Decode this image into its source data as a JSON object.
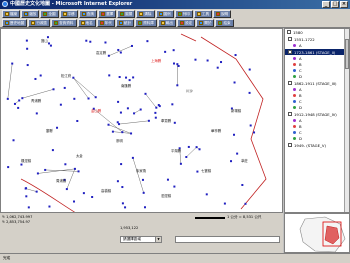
{
  "window": {
    "title": "中國歷史文化地圖 - Microsoft Internet Explorer"
  },
  "toolbar": {
    "row1": [
      {
        "label": "檔案",
        "color": "yellow"
      },
      {
        "label": "縮放",
        "color": "blue"
      },
      {
        "label": "全圖",
        "color": "green"
      },
      {
        "label": "平移",
        "color": "yellow"
      },
      {
        "label": "查詢",
        "color": "blue"
      },
      {
        "label": "選擇",
        "color": "red"
      },
      {
        "label": "圖層",
        "color": "green"
      },
      {
        "label": "清除",
        "color": "yellow"
      },
      {
        "label": "圖例",
        "color": "blue"
      },
      {
        "label": "列印",
        "color": "green"
      },
      {
        "label": "工具",
        "color": "yellow"
      },
      {
        "label": "說明",
        "color": "red"
      }
    ],
    "row2": [
      {
        "label": "歷史地圖",
        "color": "blue"
      },
      {
        "label": "行政區",
        "color": "yellow"
      },
      {
        "label": "查詢資料",
        "color": "green"
      },
      {
        "label": "地名",
        "color": "yellow"
      },
      {
        "label": "年代",
        "color": "red"
      },
      {
        "label": "統計",
        "color": "blue"
      },
      {
        "label": "資料庫",
        "color": "green"
      },
      {
        "label": "輸出",
        "color": "yellow"
      },
      {
        "label": "設定",
        "color": "red"
      },
      {
        "label": "關於",
        "color": "blue"
      },
      {
        "label": "結束",
        "color": "green"
      }
    ]
  },
  "map": {
    "places": [
      {
        "t": "寶山",
        "red": false
      },
      {
        "t": "嘉定縣",
        "red": false
      },
      {
        "t": "上海縣",
        "red": true
      },
      {
        "t": "松江府",
        "red": false
      },
      {
        "t": "南匯縣",
        "red": false
      },
      {
        "t": "川沙",
        "red": false
      },
      {
        "t": "青浦縣",
        "red": false
      },
      {
        "t": "金山縣",
        "red": true
      },
      {
        "t": "奉賢縣",
        "red": false
      },
      {
        "t": "華亭縣",
        "red": false
      },
      {
        "t": "婁縣",
        "red": false
      },
      {
        "t": "崇明",
        "red": false
      },
      {
        "t": "太倉",
        "red": false
      },
      {
        "t": "平湖縣",
        "red": false
      },
      {
        "t": "楓涇鎮",
        "red": false
      },
      {
        "t": "朱家角",
        "red": false
      },
      {
        "t": "七寶鎮",
        "red": false
      },
      {
        "t": "周浦鎮",
        "red": false
      },
      {
        "t": "高橋鎮",
        "red": false
      },
      {
        "t": "泗涇鎮",
        "red": false
      },
      {
        "t": "新場鎮",
        "red": false
      },
      {
        "t": "莘莊",
        "red": false
      }
    ]
  },
  "legend": {
    "top": "1580",
    "groups": [
      {
        "title": "1551-1722",
        "selected": false,
        "items": [
          {
            "label": "A",
            "color": "#9b30d0"
          }
        ]
      },
      {
        "title": "1723-1861 (STAGE_II)",
        "selected": true,
        "items": [
          {
            "label": "A",
            "color": "#9b30d0"
          },
          {
            "label": "B",
            "color": "#e04040"
          },
          {
            "label": "C",
            "color": "#3060d0"
          },
          {
            "label": "D",
            "color": "#30a040"
          }
        ]
      },
      {
        "title": "1862-1911 (STAGE_III)",
        "selected": false,
        "items": [
          {
            "label": "A",
            "color": "#9b30d0"
          },
          {
            "label": "B",
            "color": "#e04040"
          },
          {
            "label": "C",
            "color": "#3060d0"
          },
          {
            "label": "D",
            "color": "#30a040"
          }
        ]
      },
      {
        "title": "1912-1948 (STAGE_IV)",
        "selected": false,
        "items": [
          {
            "label": "A",
            "color": "#9b30d0"
          },
          {
            "label": "B",
            "color": "#e04040"
          },
          {
            "label": "C",
            "color": "#3060d0"
          },
          {
            "label": "D",
            "color": "#30a040"
          }
        ]
      },
      {
        "title": "1949- (STAGE_V)",
        "selected": false,
        "items": []
      }
    ]
  },
  "status": {
    "coord_y1": "Y: 1,062,743.997",
    "coord_y2": "Y: 2,853,754.97",
    "coord_x": "1,953,122",
    "scale_label": "1 公分 = 8,531 公尺",
    "select_value": "請選擇區域",
    "ie_status": "完成"
  },
  "colors": {
    "route": "#6b6b6b",
    "node": "#2020c0",
    "border": "#c02020",
    "water": "#e04040"
  }
}
